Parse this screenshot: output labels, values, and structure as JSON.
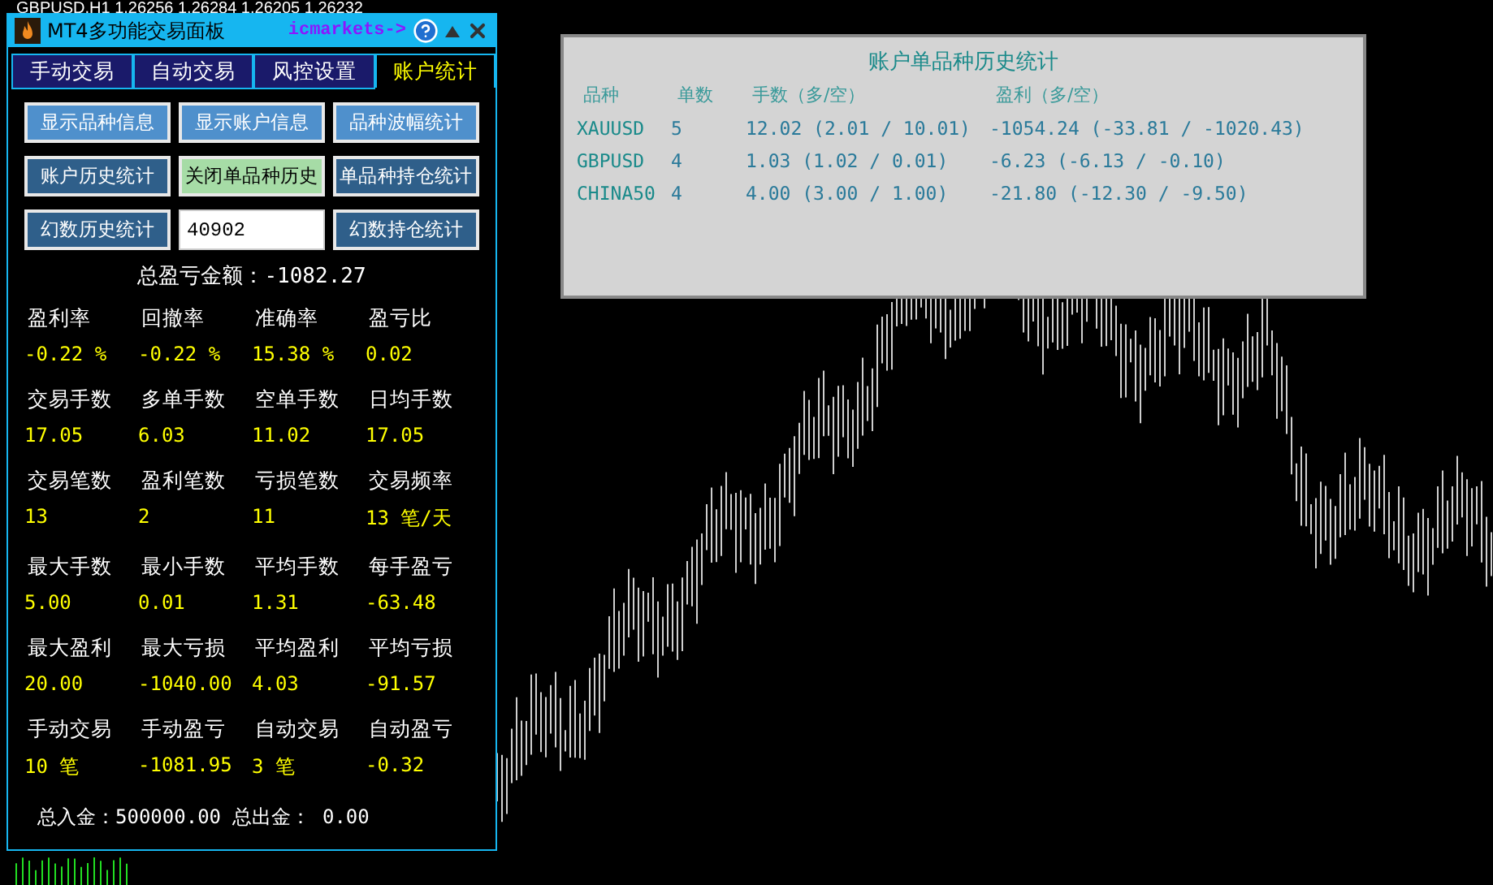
{
  "chart_header": "GBPUSD,H1  1.26256 1.26284 1.26205 1.26232",
  "panel": {
    "title": "MT4多功能交易面板",
    "broker_link": "icmarkets->",
    "tabs": [
      {
        "label": "手动交易",
        "selected": false
      },
      {
        "label": "自动交易",
        "selected": false
      },
      {
        "label": "风控设置",
        "selected": false
      },
      {
        "label": "账户统计",
        "selected": true
      }
    ],
    "controls": [
      {
        "kind": "light",
        "label": "显示品种信息"
      },
      {
        "kind": "light",
        "label": "显示账户信息"
      },
      {
        "kind": "light",
        "label": "品种波幅统计"
      },
      {
        "kind": "dark",
        "label": "账户历史统计"
      },
      {
        "kind": "pressed",
        "label": "关闭单品种历史"
      },
      {
        "kind": "dark",
        "label": "单品种持仓统计"
      },
      {
        "kind": "dark",
        "label": "幻数历史统计"
      },
      {
        "kind": "input",
        "value": "40902"
      },
      {
        "kind": "dark",
        "label": "幻数持仓统计"
      }
    ],
    "total": "总盈亏金额：-1082.27",
    "stat_groups": [
      [
        {
          "label": "盈利率",
          "value": "-0.22 %"
        },
        {
          "label": "回撤率",
          "value": "-0.22 %"
        },
        {
          "label": "准确率",
          "value": "15.38 %"
        },
        {
          "label": "盈亏比",
          "value": "0.02"
        }
      ],
      [
        {
          "label": "交易手数",
          "value": "17.05"
        },
        {
          "label": "多单手数",
          "value": "6.03"
        },
        {
          "label": "空单手数",
          "value": "11.02"
        },
        {
          "label": "日均手数",
          "value": "17.05"
        }
      ],
      [
        {
          "label": "交易笔数",
          "value": "13"
        },
        {
          "label": "盈利笔数",
          "value": "2"
        },
        {
          "label": "亏损笔数",
          "value": "11"
        },
        {
          "label": "交易频率",
          "value": "13 笔/天"
        }
      ],
      [
        {
          "label": "最大手数",
          "value": "5.00"
        },
        {
          "label": "最小手数",
          "value": "0.01"
        },
        {
          "label": "平均手数",
          "value": "1.31"
        },
        {
          "label": "每手盈亏",
          "value": "-63.48"
        }
      ],
      [
        {
          "label": "最大盈利",
          "value": "20.00"
        },
        {
          "label": "最大亏损",
          "value": "-1040.00"
        },
        {
          "label": "平均盈利",
          "value": "4.03"
        },
        {
          "label": "平均亏损",
          "value": "-91.57"
        }
      ],
      [
        {
          "label": "手动交易",
          "value": "10 笔"
        },
        {
          "label": "手动盈亏",
          "value": "-1081.95"
        },
        {
          "label": "自动交易",
          "value": "3 笔"
        },
        {
          "label": "自动盈亏",
          "value": "-0.32"
        }
      ]
    ],
    "footer": "总入金：500000.00 总出金： 0.00"
  },
  "history": {
    "title": "账户单品种历史统计",
    "columns": [
      "品种",
      "单数",
      "手数（多/空）",
      "盈利（多/空）"
    ],
    "rows": [
      [
        "XAUUSD",
        "5",
        "12.02 (2.01 / 10.01)",
        "-1054.24 (-33.81 / -1020.43)"
      ],
      [
        "GBPUSD",
        "4",
        "1.03 (1.02 / 0.01)",
        "-6.23 (-6.13 / -0.10)"
      ],
      [
        "CHINA50",
        "4",
        "4.00 (3.00 / 1.00)",
        "-21.80 (-12.30 / -9.50)"
      ]
    ]
  }
}
